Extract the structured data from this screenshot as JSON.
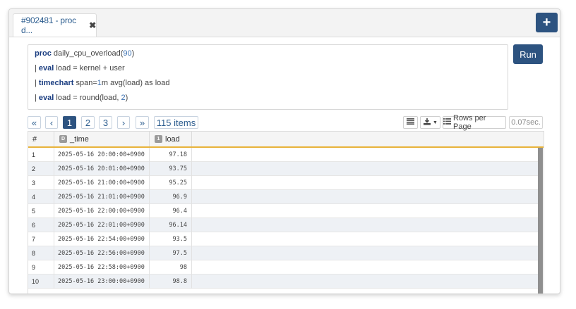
{
  "tab": {
    "title": "#902481 - proc d...",
    "close_icon": "close-icon"
  },
  "toolbar": {
    "add_label": "+",
    "run_label": "Run"
  },
  "query": {
    "line1": {
      "kw": "proc",
      "text": " daily_cpu_overload(",
      "num": "90",
      "end": ")"
    },
    "line2": {
      "prefix": "| ",
      "kw": "eval",
      "text": " load = kernel + user"
    },
    "line3": {
      "prefix": "| ",
      "kw": "timechart",
      "text": " span=",
      "num": "1",
      "end": "m avg(load) as load"
    },
    "line4": {
      "prefix": "| ",
      "kw": "eval",
      "text": " load = round(load, ",
      "num": "2",
      "end": ")"
    }
  },
  "pagination": {
    "first": "«",
    "prev": "‹",
    "pages": [
      "1",
      "2",
      "3"
    ],
    "current_page": "1",
    "next": "›",
    "last": "»",
    "items_count": "115 items"
  },
  "tools": {
    "rows_per_page_label": "Rows per Page",
    "timing": "0.07sec."
  },
  "table": {
    "headers": {
      "index": "#",
      "time": "_time",
      "time_type": "D",
      "load": "load",
      "load_type": "1"
    },
    "rows": [
      {
        "n": "1",
        "time": "2025-05-16 20:00:00+0900",
        "load": "97.18"
      },
      {
        "n": "2",
        "time": "2025-05-16 20:01:00+0900",
        "load": "93.75"
      },
      {
        "n": "3",
        "time": "2025-05-16 21:00:00+0900",
        "load": "95.25"
      },
      {
        "n": "4",
        "time": "2025-05-16 21:01:00+0900",
        "load": "96.9"
      },
      {
        "n": "5",
        "time": "2025-05-16 22:00:00+0900",
        "load": "96.4"
      },
      {
        "n": "6",
        "time": "2025-05-16 22:01:00+0900",
        "load": "96.14"
      },
      {
        "n": "7",
        "time": "2025-05-16 22:54:00+0900",
        "load": "93.5"
      },
      {
        "n": "8",
        "time": "2025-05-16 22:56:00+0900",
        "load": "97.5"
      },
      {
        "n": "9",
        "time": "2025-05-16 22:58:00+0900",
        "load": "98"
      },
      {
        "n": "10",
        "time": "2025-05-16 23:00:00+0900",
        "load": "98.8"
      }
    ]
  },
  "colors": {
    "accent": "#2d5380",
    "header_underline": "#e8b33a",
    "row_alt": "#eef1f5"
  }
}
